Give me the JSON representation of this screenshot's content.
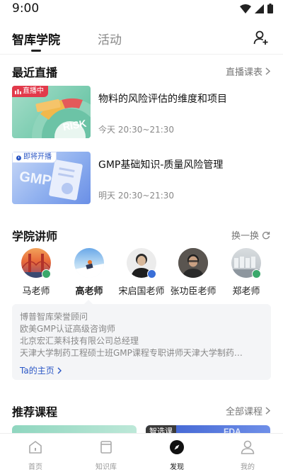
{
  "status_bar": {
    "time": "9:00"
  },
  "top_tabs": {
    "active": "智库学院",
    "inactive": "活动"
  },
  "live": {
    "title": "最近直播",
    "link": "直播课表",
    "items": [
      {
        "badge": "直播中",
        "thumb_text_1": "直播中",
        "thumb_text_2": "RISK",
        "title": "物料的风险评估的维度和项目",
        "time": "今天 20:30~21:30"
      },
      {
        "badge": "即将开播",
        "thumb_text": "GMP",
        "title": "GMP基础知识-质量风险管理",
        "time": "明天 20:30~21:30"
      }
    ]
  },
  "teachers": {
    "title": "学院讲师",
    "refresh": "换一换",
    "items": [
      {
        "name": "马老师"
      },
      {
        "name": "高老师"
      },
      {
        "name": "宋启国老师"
      },
      {
        "name": "张功臣老师"
      },
      {
        "name": "郑老师"
      }
    ],
    "bio": [
      "博普智库荣誉顾问",
      "欧美GMP认证高级咨询师",
      "北京宏汇莱科技有限公司总经理",
      "天津大学制药工程硕士班GMP课程专职讲师天津大学制药…"
    ],
    "home_link": "Ta的主页"
  },
  "courses": {
    "title": "推荐课程",
    "link": "全部课程",
    "card2_badge": "智选课",
    "card2_text": "FDA"
  },
  "bottom_nav": [
    {
      "label": "首页",
      "icon": "home-icon"
    },
    {
      "label": "知识库",
      "icon": "book-icon"
    },
    {
      "label": "发现",
      "icon": "compass-icon",
      "active": true
    },
    {
      "label": "我的",
      "icon": "person-icon"
    }
  ]
}
